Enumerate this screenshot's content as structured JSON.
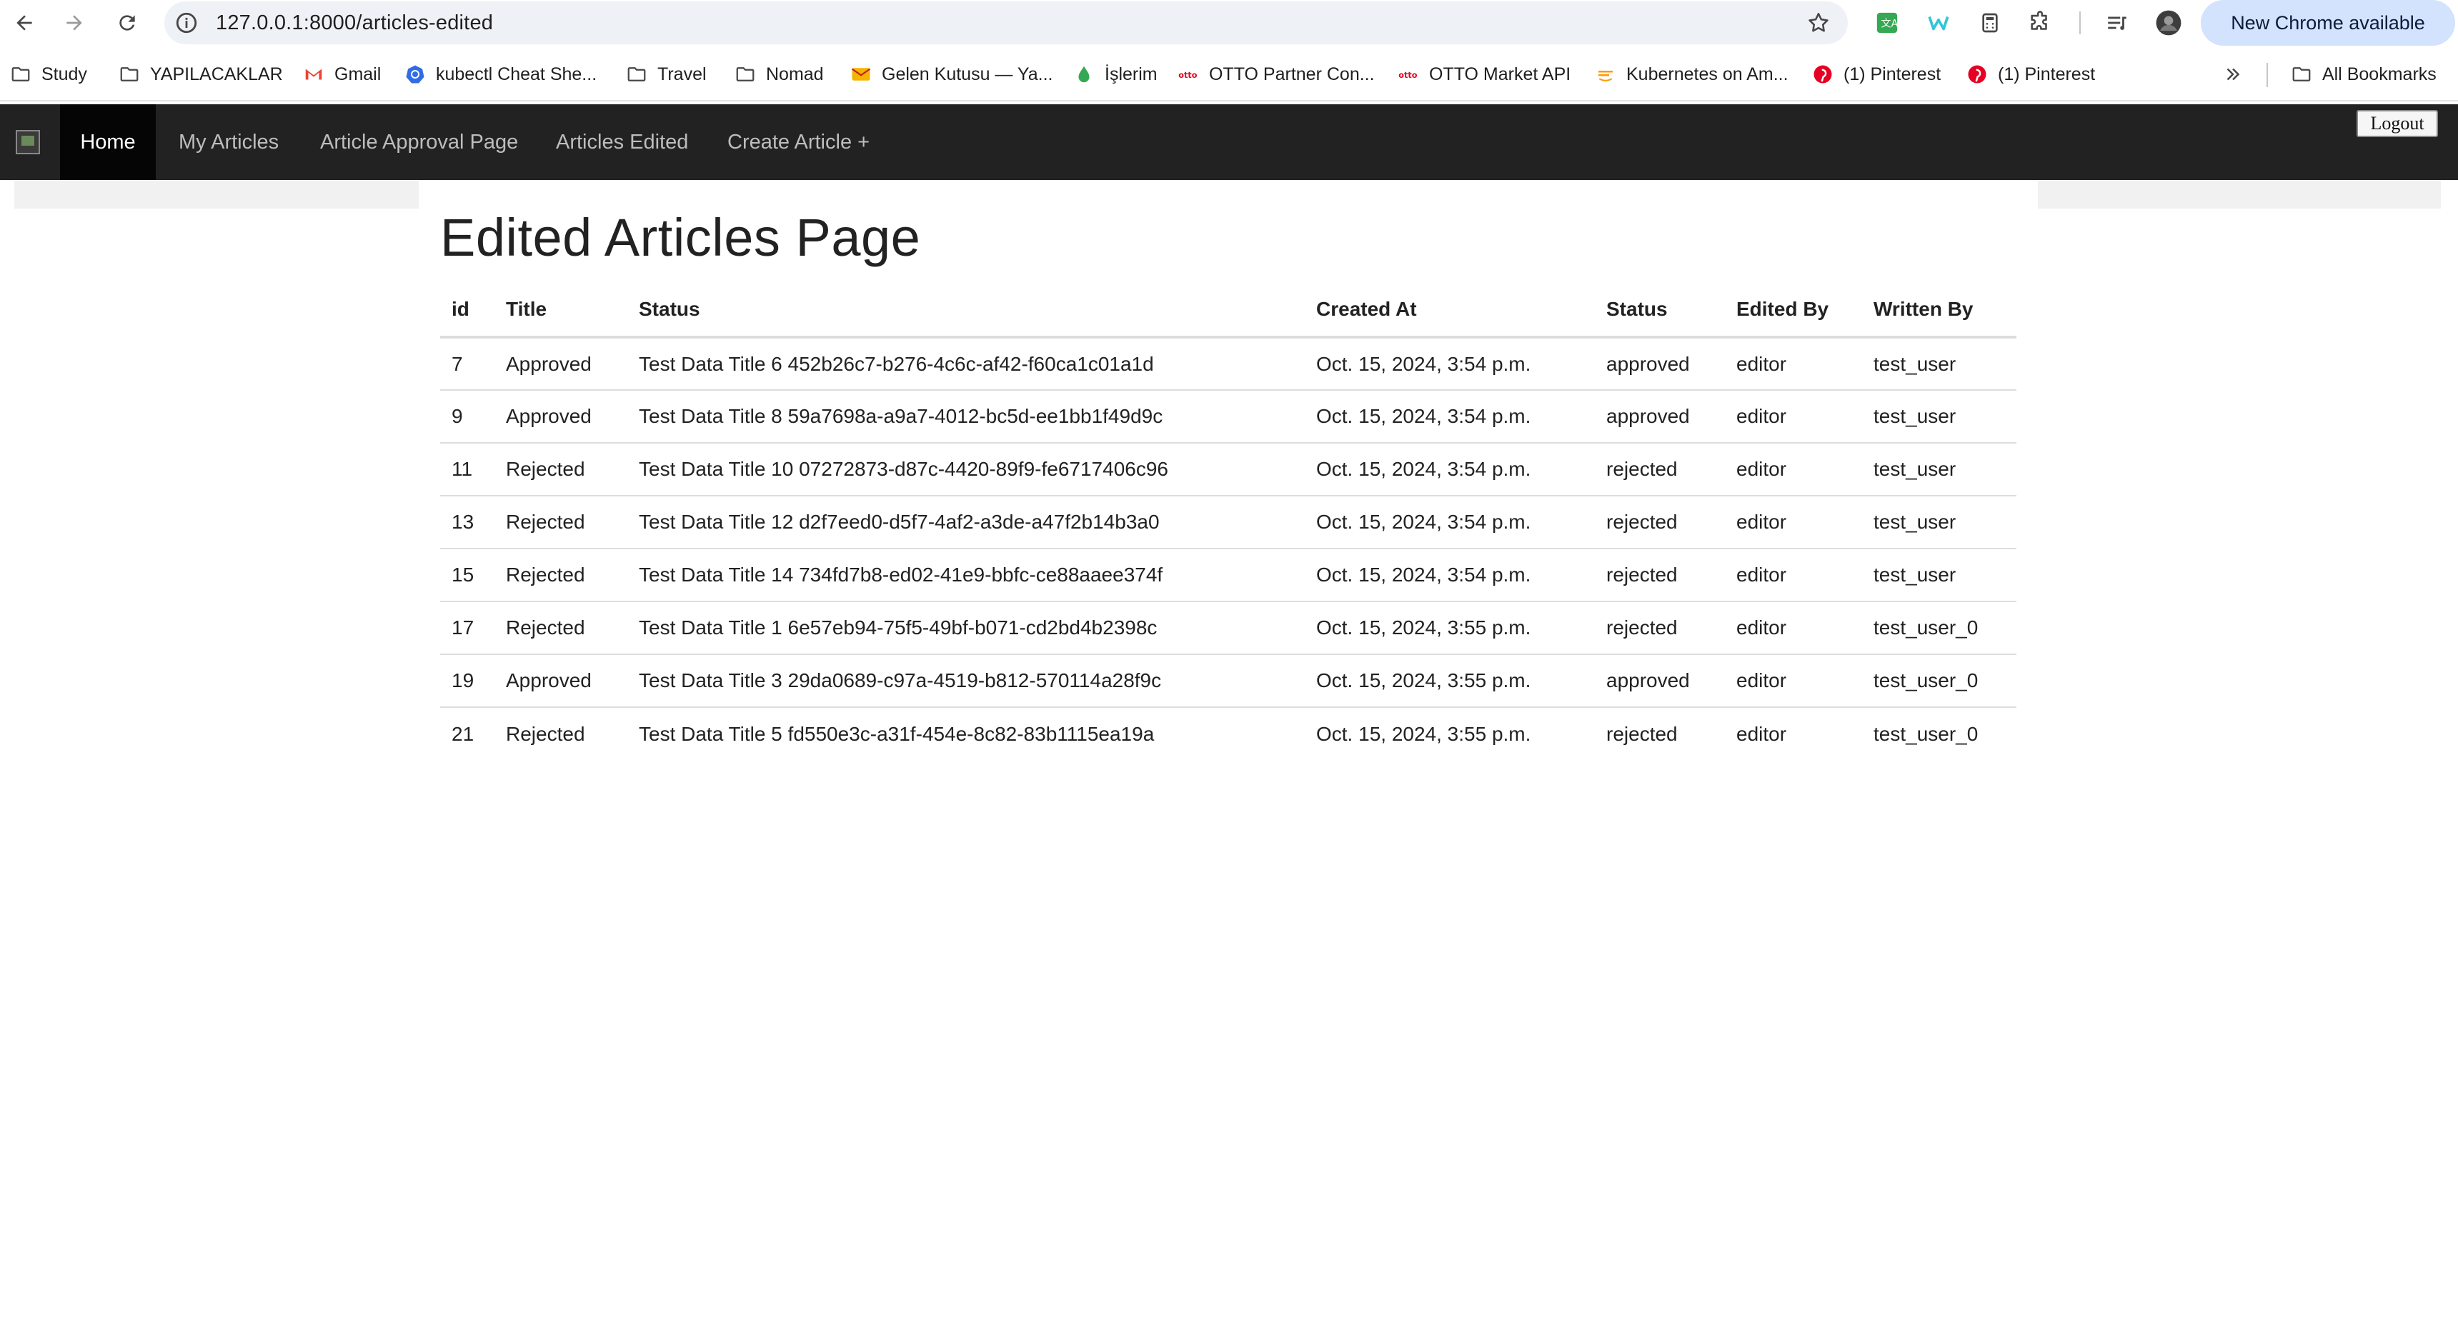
{
  "browser": {
    "url": "127.0.0.1:8000/articles-edited",
    "new_chrome_label": "New Chrome available",
    "bookmarks": [
      {
        "label": "Study",
        "icon": "folder-icon"
      },
      {
        "label": "YAPILACAKLAR",
        "icon": "folder-icon"
      },
      {
        "label": "Gmail",
        "icon": "gmail-icon"
      },
      {
        "label": "kubectl Cheat She...",
        "icon": "kubernetes-icon"
      },
      {
        "label": "Travel",
        "icon": "folder-icon"
      },
      {
        "label": "Nomad",
        "icon": "folder-icon"
      },
      {
        "label": "Gelen Kutusu — Ya...",
        "icon": "mail-icon"
      },
      {
        "label": "İşlerim",
        "icon": "drop-icon"
      },
      {
        "label": "OTTO Partner Con...",
        "icon": "otto-icon"
      },
      {
        "label": "OTTO Market API",
        "icon": "otto-icon"
      },
      {
        "label": "Kubernetes on Am...",
        "icon": "aws-icon"
      },
      {
        "label": "(1) Pinterest",
        "icon": "pinterest-icon"
      },
      {
        "label": "(1) Pinterest",
        "icon": "pinterest-icon"
      }
    ],
    "all_bookmarks_label": "All Bookmarks"
  },
  "site_nav": {
    "links": [
      "Home",
      "My Articles",
      "Article Approval Page",
      "Articles Edited",
      "Create Article +"
    ],
    "active": "Home",
    "logout_label": "Logout"
  },
  "page": {
    "title": "Edited Articles Page"
  },
  "table": {
    "headers": [
      "id",
      "Title",
      "Status",
      "Created At",
      "Status",
      "Edited By",
      "Written By"
    ],
    "rows": [
      [
        "7",
        "Approved",
        "Test Data Title 6 452b26c7-b276-4c6c-af42-f60ca1c01a1d",
        "Oct. 15, 2024, 3:54 p.m.",
        "approved",
        "editor",
        "test_user"
      ],
      [
        "9",
        "Approved",
        "Test Data Title 8 59a7698a-a9a7-4012-bc5d-ee1bb1f49d9c",
        "Oct. 15, 2024, 3:54 p.m.",
        "approved",
        "editor",
        "test_user"
      ],
      [
        "11",
        "Rejected",
        "Test Data Title 10 07272873-d87c-4420-89f9-fe6717406c96",
        "Oct. 15, 2024, 3:54 p.m.",
        "rejected",
        "editor",
        "test_user"
      ],
      [
        "13",
        "Rejected",
        "Test Data Title 12 d2f7eed0-d5f7-4af2-a3de-a47f2b14b3a0",
        "Oct. 15, 2024, 3:54 p.m.",
        "rejected",
        "editor",
        "test_user"
      ],
      [
        "15",
        "Rejected",
        "Test Data Title 14 734fd7b8-ed02-41e9-bbfc-ce88aaee374f",
        "Oct. 15, 2024, 3:54 p.m.",
        "rejected",
        "editor",
        "test_user"
      ],
      [
        "17",
        "Rejected",
        "Test Data Title 1 6e57eb94-75f5-49bf-b071-cd2bd4b2398c",
        "Oct. 15, 2024, 3:55 p.m.",
        "rejected",
        "editor",
        "test_user_0"
      ],
      [
        "19",
        "Approved",
        "Test Data Title 3 29da0689-c97a-4519-b812-570114a28f9c",
        "Oct. 15, 2024, 3:55 p.m.",
        "approved",
        "editor",
        "test_user_0"
      ],
      [
        "21",
        "Rejected",
        "Test Data Title 5 fd550e3c-a31f-454e-8c82-83b1115ea19a",
        "Oct. 15, 2024, 3:55 p.m.",
        "rejected",
        "editor",
        "test_user_0"
      ]
    ]
  },
  "colors": {
    "navbar_bg": "#222222",
    "navbar_active_bg": "#050505",
    "omnibox_bg": "#eef1f6",
    "new_chrome_bg": "#d3e3fd"
  }
}
